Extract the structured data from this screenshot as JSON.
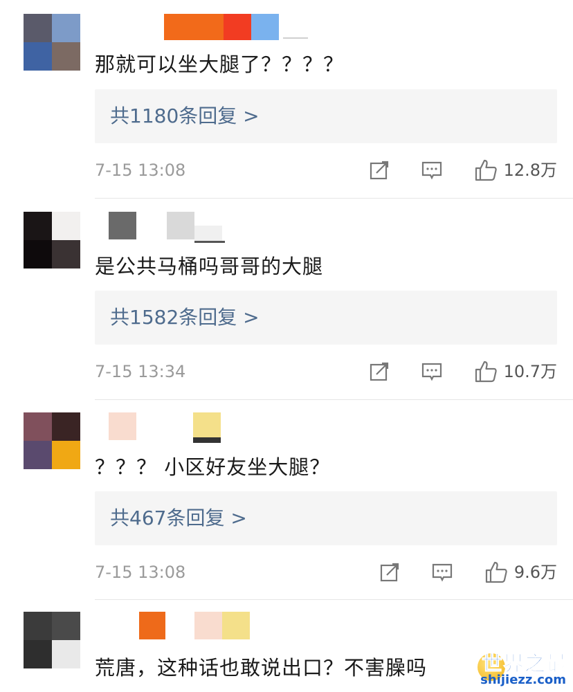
{
  "comments": [
    {
      "text": "那就可以坐大腿了？？？？",
      "replies": "共1180条回复 >",
      "time": "7-15 13:08",
      "likes": "12.8万",
      "colors": {
        "avatar": [
          "#5a5a6a",
          "#7d9bc8",
          "#3f63a3",
          "#7c6a63"
        ]
      }
    },
    {
      "text": "是公共马桶吗哥哥的大腿",
      "replies": "共1582条回复 >",
      "time": "7-15 13:34",
      "likes": "10.7万",
      "colors": {
        "avatar": [
          "#1a1516",
          "#f2f0ef",
          "#0e0a0c",
          "#3a3233"
        ]
      }
    },
    {
      "text": "？？？ 小区好友坐大腿？",
      "replies": "共467条回复 >",
      "time": "7-15 13:08",
      "likes": "9.6万",
      "colors": {
        "avatar": [
          "#80505c",
          "#3a2424",
          "#5a4a6e",
          "#f0a814"
        ]
      }
    },
    {
      "text": "荒唐，这种话也敢说出口？不害臊吗",
      "colors": {
        "avatar": [
          "#3b3b3b",
          "#4a4a4a",
          "#2e2e2e",
          "#e9e9e9"
        ]
      }
    }
  ],
  "icons": [
    "share-icon",
    "comment-icon",
    "like-icon"
  ],
  "watermark": {
    "title": "世界之最",
    "url": "shijiezz.com"
  }
}
